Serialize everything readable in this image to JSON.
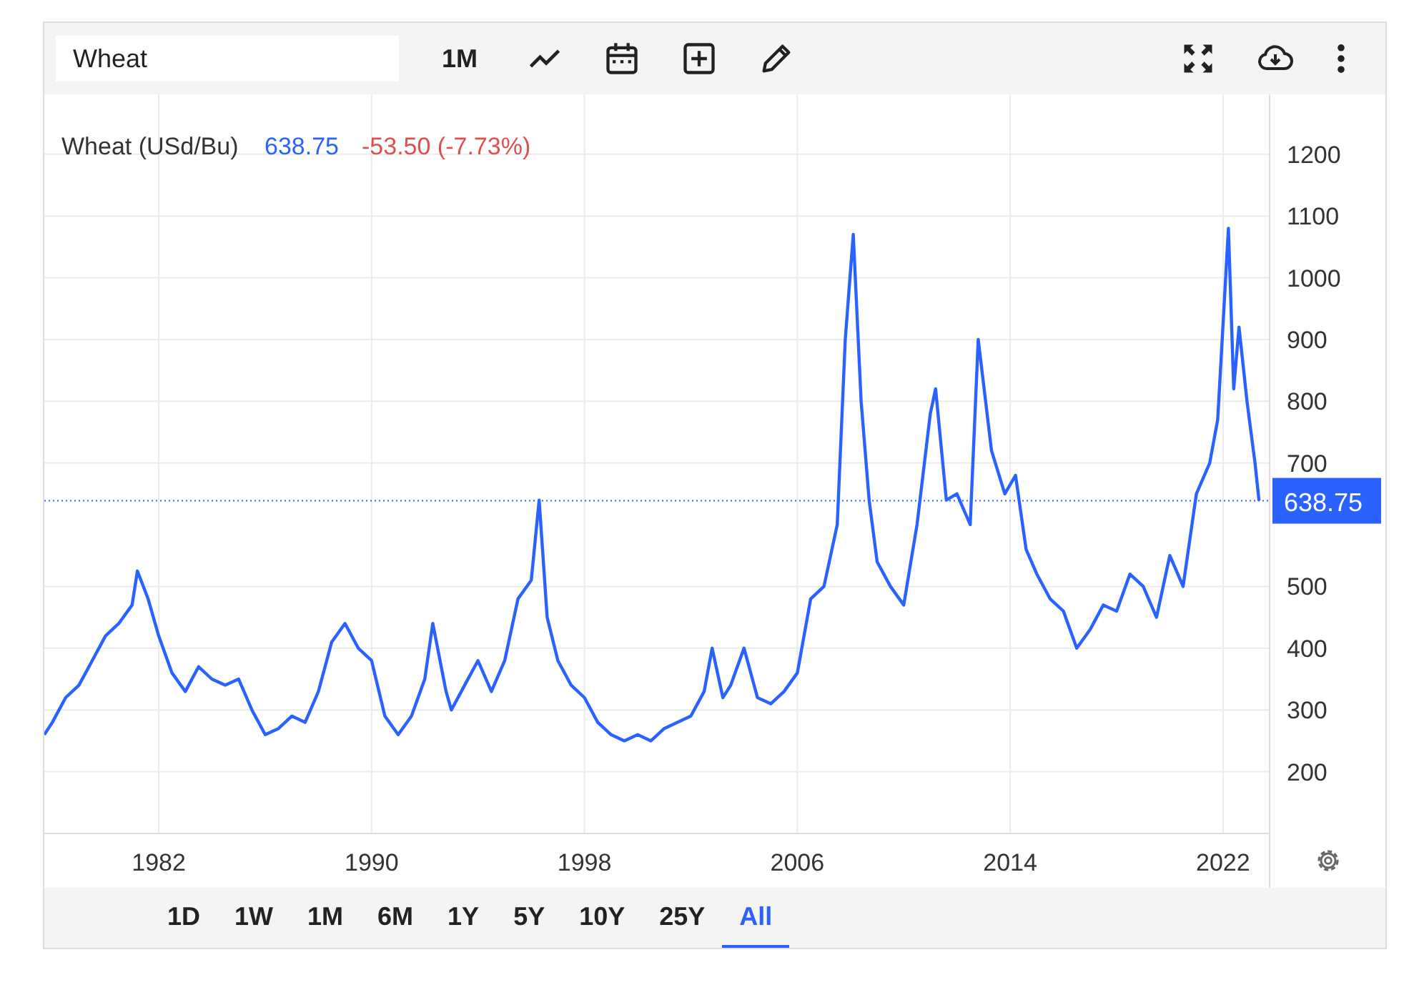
{
  "toolbar": {
    "symbol": "Wheat",
    "interval": "1M"
  },
  "legend": {
    "name": "Wheat (USd/Bu)",
    "price": "638.75",
    "change": "-53.50 (-7.73%)"
  },
  "chart_data": {
    "type": "line",
    "xlim": [
      1977.7,
      2023.75
    ],
    "ylim": [
      100,
      1297
    ],
    "xticks": [
      1982,
      1990,
      1998,
      2006,
      2014,
      2022
    ],
    "yticks": [
      200,
      300,
      400,
      500,
      700,
      800,
      900,
      1000,
      1100,
      1200
    ],
    "grid": true,
    "ref_lines": [
      {
        "axis": "y",
        "value": 638.75,
        "label": "638.75",
        "color": "#2962ff"
      }
    ],
    "x": [
      1977.7,
      1978,
      1978.5,
      1979,
      1979.5,
      1980,
      1980.5,
      1981,
      1981.2,
      1981.6,
      1982,
      1982.5,
      1983,
      1983.5,
      1984,
      1984.5,
      1985,
      1985.5,
      1986,
      1986.5,
      1987,
      1987.5,
      1988,
      1988.5,
      1989,
      1989.5,
      1990,
      1990.5,
      1991,
      1991.5,
      1992,
      1992.3,
      1992.8,
      1993,
      1993.5,
      1994,
      1994.5,
      1995,
      1995.5,
      1996,
      1996.3,
      1996.6,
      1997,
      1997.5,
      1998,
      1998.5,
      1999,
      1999.5,
      2000,
      2000.5,
      2001,
      2001.5,
      2002,
      2002.5,
      2002.8,
      2003.2,
      2003.5,
      2004,
      2004.5,
      2005,
      2005.5,
      2006,
      2006.5,
      2007,
      2007.5,
      2007.8,
      2008.1,
      2008.4,
      2008.7,
      2009,
      2009.5,
      2010,
      2010.5,
      2011,
      2011.2,
      2011.6,
      2012,
      2012.5,
      2012.8,
      2013.3,
      2013.8,
      2014.2,
      2014.6,
      2015,
      2015.5,
      2016,
      2016.5,
      2017,
      2017.5,
      2018,
      2018.5,
      2019,
      2019.5,
      2020,
      2020.5,
      2021,
      2021.5,
      2021.8,
      2022.2,
      2022.4,
      2022.6,
      2022.9,
      2023.2,
      2023.35
    ],
    "series": [
      {
        "color": "#2962ff",
        "values": [
          260,
          280,
          320,
          340,
          380,
          420,
          440,
          470,
          525,
          480,
          420,
          360,
          330,
          370,
          350,
          340,
          350,
          300,
          260,
          270,
          290,
          280,
          330,
          410,
          440,
          400,
          380,
          290,
          260,
          290,
          350,
          440,
          330,
          300,
          340,
          380,
          330,
          380,
          480,
          510,
          640,
          450,
          380,
          340,
          320,
          280,
          260,
          250,
          260,
          250,
          270,
          280,
          290,
          330,
          400,
          320,
          340,
          400,
          320,
          310,
          330,
          360,
          480,
          500,
          600,
          900,
          1070,
          800,
          640,
          540,
          500,
          470,
          600,
          780,
          820,
          640,
          650,
          600,
          900,
          720,
          650,
          680,
          560,
          520,
          480,
          460,
          400,
          430,
          470,
          460,
          520,
          500,
          450,
          550,
          500,
          650,
          700,
          770,
          1080,
          820,
          920,
          800,
          700,
          639
        ]
      }
    ]
  },
  "ranges": [
    {
      "label": "1D",
      "selected": false
    },
    {
      "label": "1W",
      "selected": false
    },
    {
      "label": "1M",
      "selected": false
    },
    {
      "label": "6M",
      "selected": false
    },
    {
      "label": "1Y",
      "selected": false
    },
    {
      "label": "5Y",
      "selected": false
    },
    {
      "label": "10Y",
      "selected": false
    },
    {
      "label": "25Y",
      "selected": false
    },
    {
      "label": "All",
      "selected": true
    }
  ]
}
